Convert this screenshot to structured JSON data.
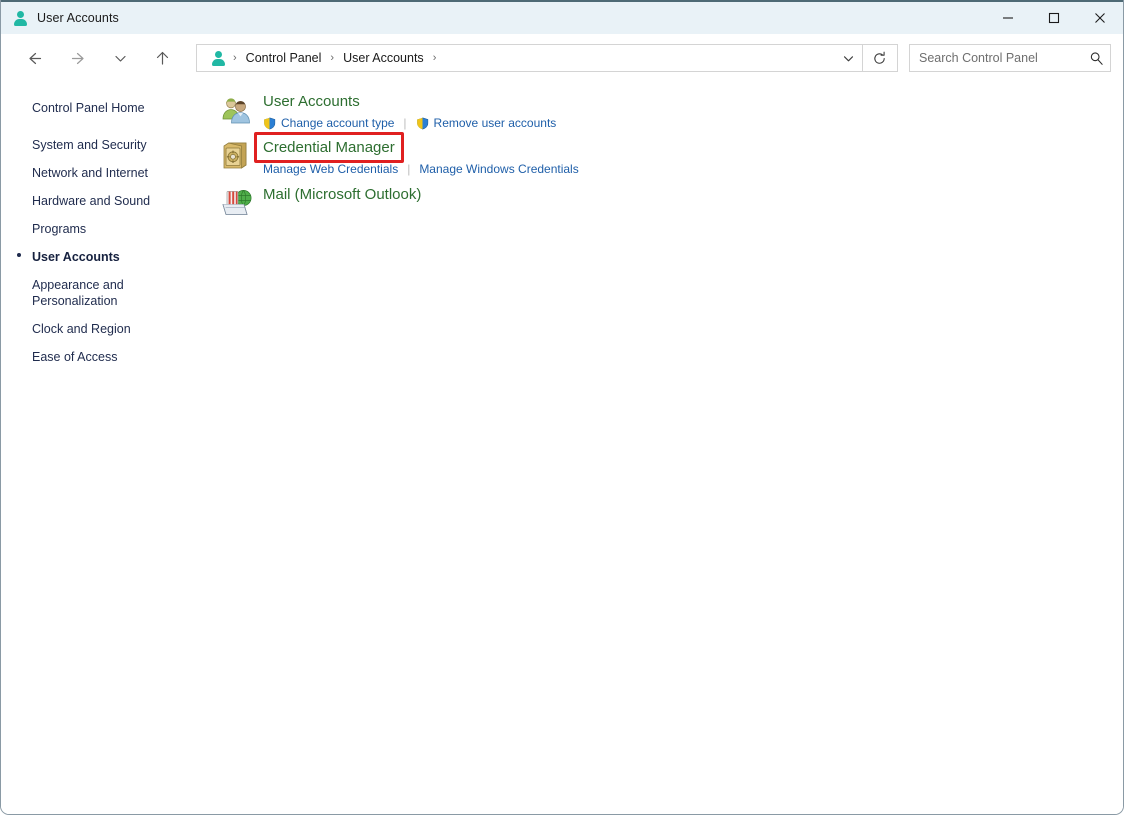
{
  "window": {
    "title": "User Accounts",
    "title_icon": "user-account-icon",
    "controls": {
      "minimize": "minimize-icon",
      "maximize": "maximize-icon",
      "close": "close-icon"
    }
  },
  "navbar": {
    "back": "back-arrow-icon",
    "forward": "forward-arrow-icon",
    "recent": "chevron-down-icon",
    "up": "up-arrow-icon",
    "address": {
      "icon": "user-account-icon",
      "crumbs": [
        "Control Panel",
        "User Accounts"
      ],
      "separator": "›",
      "dropdown": "chevron-down-icon",
      "refresh": "refresh-icon"
    },
    "search": {
      "placeholder": "Search Control Panel",
      "value": "",
      "icon": "search-icon"
    }
  },
  "sidebar": {
    "items": [
      {
        "label": "Control Panel Home",
        "current": false,
        "home": true
      },
      {
        "label": "System and Security",
        "current": false,
        "home": false
      },
      {
        "label": "Network and Internet",
        "current": false,
        "home": false
      },
      {
        "label": "Hardware and Sound",
        "current": false,
        "home": false
      },
      {
        "label": "Programs",
        "current": false,
        "home": false
      },
      {
        "label": "User Accounts",
        "current": true,
        "home": false
      },
      {
        "label": "Appearance and Personalization",
        "current": false,
        "home": false
      },
      {
        "label": "Clock and Region",
        "current": false,
        "home": false
      },
      {
        "label": "Ease of Access",
        "current": false,
        "home": false
      }
    ]
  },
  "main": {
    "categories": [
      {
        "title": "User Accounts",
        "icon": "users-icon",
        "highlighted": false,
        "links": [
          {
            "label": "Change account type",
            "shield": true
          },
          {
            "label": "Remove user accounts",
            "shield": true
          }
        ]
      },
      {
        "title": "Credential Manager",
        "icon": "vault-icon",
        "highlighted": true,
        "links": [
          {
            "label": "Manage Web Credentials",
            "shield": false
          },
          {
            "label": "Manage Windows Credentials",
            "shield": false
          }
        ]
      },
      {
        "title": "Mail (Microsoft Outlook)",
        "icon": "mail-icon",
        "highlighted": false,
        "links": []
      }
    ],
    "link_separator": "|"
  },
  "colors": {
    "titlebar_bg": "#e9f2f7",
    "accent_teal": "#21b8a4",
    "category_title_green": "#2d6e30",
    "link_blue": "#1f5fa9",
    "sidebar_text": "#1f2b4d",
    "highlight_red": "#e02020"
  }
}
